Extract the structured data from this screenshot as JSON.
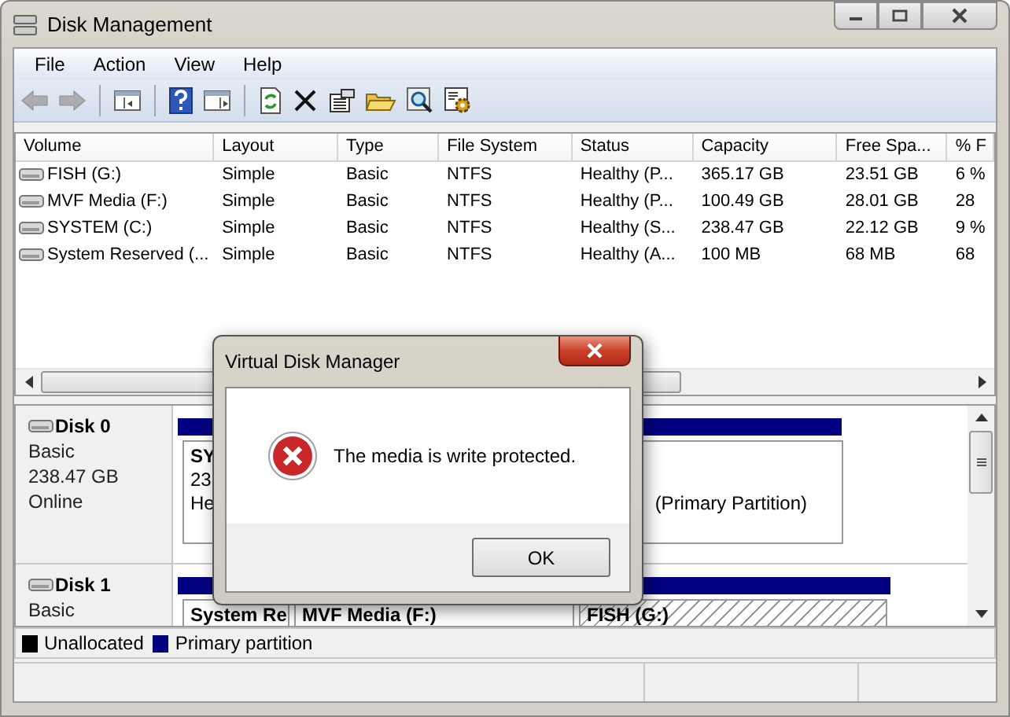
{
  "window": {
    "title": "Disk Management"
  },
  "menu": [
    "File",
    "Action",
    "View",
    "Help"
  ],
  "toolbar": [
    {
      "kind": "back",
      "disabled": true
    },
    {
      "kind": "forward",
      "disabled": true
    },
    {
      "kind": "sep"
    },
    {
      "kind": "tree",
      "disabled": false
    },
    {
      "kind": "sep"
    },
    {
      "kind": "help",
      "disabled": false
    },
    {
      "kind": "pane",
      "disabled": false
    },
    {
      "kind": "sep"
    },
    {
      "kind": "refresh",
      "disabled": false
    },
    {
      "kind": "delete",
      "disabled": false
    },
    {
      "kind": "properties",
      "disabled": false
    },
    {
      "kind": "open",
      "disabled": false
    },
    {
      "kind": "explore",
      "disabled": false
    },
    {
      "kind": "settings",
      "disabled": false
    }
  ],
  "table": {
    "columns": [
      "Volume",
      "Layout",
      "Type",
      "File System",
      "Status",
      "Capacity",
      "Free Spa...",
      "% F"
    ],
    "rows": [
      [
        "FISH (G:)",
        "Simple",
        "Basic",
        "NTFS",
        "Healthy (P...",
        "365.17 GB",
        "23.51 GB",
        "6 %"
      ],
      [
        "MVF Media (F:)",
        "Simple",
        "Basic",
        "NTFS",
        "Healthy (P...",
        "100.49 GB",
        "28.01 GB",
        "28"
      ],
      [
        "SYSTEM (C:)",
        "Simple",
        "Basic",
        "NTFS",
        "Healthy (S...",
        "238.47 GB",
        "22.12 GB",
        "9 %"
      ],
      [
        "System Reserved (...",
        "Simple",
        "Basic",
        "NTFS",
        "Healthy (A...",
        "100 MB",
        "68 MB",
        "68"
      ]
    ]
  },
  "disks": [
    {
      "name": "Disk 0",
      "lines": [
        "Basic",
        "238.47 GB",
        "Online"
      ],
      "partitions": [
        {
          "title": "SY",
          "lines": [
            "23",
            "He"
          ],
          "tail": "(Primary Partition)",
          "hatched": false
        }
      ]
    },
    {
      "name": "Disk 1",
      "lines": [
        "Basic"
      ],
      "partitions": [
        {
          "title": "System Re",
          "hatched": false
        },
        {
          "title": "MVF Media  (F:)",
          "hatched": false
        },
        {
          "title": "FISH  (G:)",
          "hatched": true
        }
      ]
    }
  ],
  "legend": [
    {
      "label": "Unallocated",
      "color": "#000000"
    },
    {
      "label": "Primary partition",
      "color": "#000080"
    }
  ],
  "dialog": {
    "title": "Virtual Disk Manager",
    "message": "The media is write protected.",
    "button": "OK"
  }
}
